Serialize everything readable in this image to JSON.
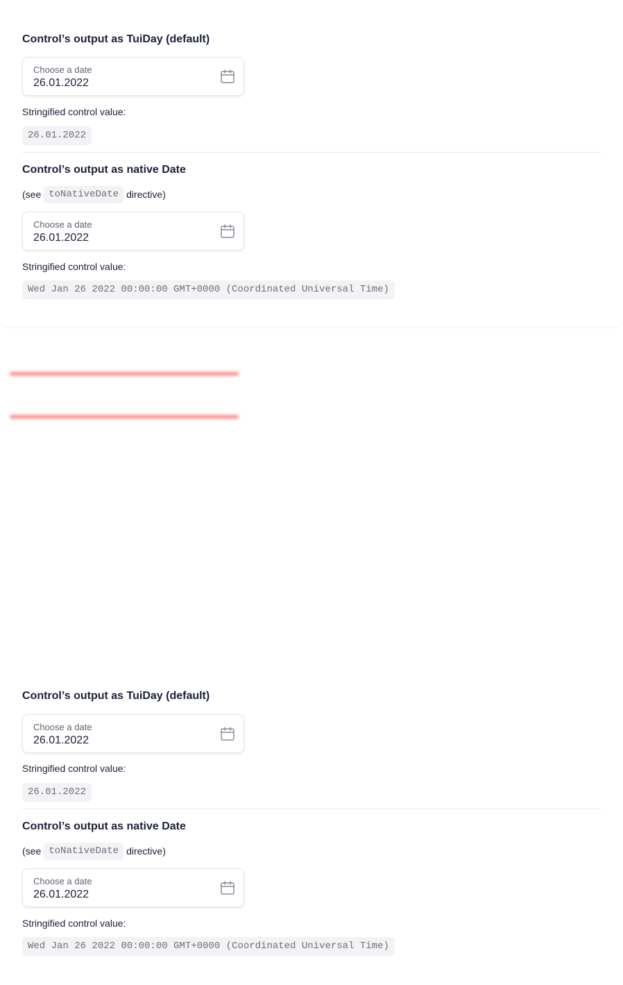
{
  "sections": [
    {
      "tuiday": {
        "heading": "Control’s output as TuiDay (default)",
        "field_label": "Choose a date",
        "field_value": "26.01.2022",
        "caption": "Stringified control value:",
        "output": "26.01.2022"
      },
      "native": {
        "heading": "Control’s output as native Date",
        "see_prefix": "(see",
        "see_code": "toNativeDate",
        "see_suffix": "directive)",
        "field_label": "Choose a date",
        "field_value": "26.01.2022",
        "caption": "Stringified control value:",
        "output": "Wed Jan 26 2022 00:00:00 GMT+0000 (Coordinated Universal Time)"
      }
    },
    {
      "tuiday": {
        "heading": "Control’s output as TuiDay (default)",
        "field_label": "Choose a date",
        "field_value": "26.01.2022",
        "caption": "Stringified control value:",
        "output": "26.01.2022"
      },
      "native": {
        "heading": "Control’s output as native Date",
        "see_prefix": "(see",
        "see_code": "toNativeDate",
        "see_suffix": "directive)",
        "field_label": "Choose a date",
        "field_value": "26.01.2022",
        "caption": "Stringified control value:",
        "output": "Wed Jan 26 2022 00:00:00 GMT+0000 (Coordinated Universal Time)"
      }
    }
  ],
  "icons": {
    "field_icon": "calendar-icon"
  },
  "colors": {
    "text": "#1b1f3b",
    "muted": "#5e6270",
    "code_bg": "#f3f3f5",
    "border": "#e7e7ea",
    "red_mark": "#ff5757"
  }
}
